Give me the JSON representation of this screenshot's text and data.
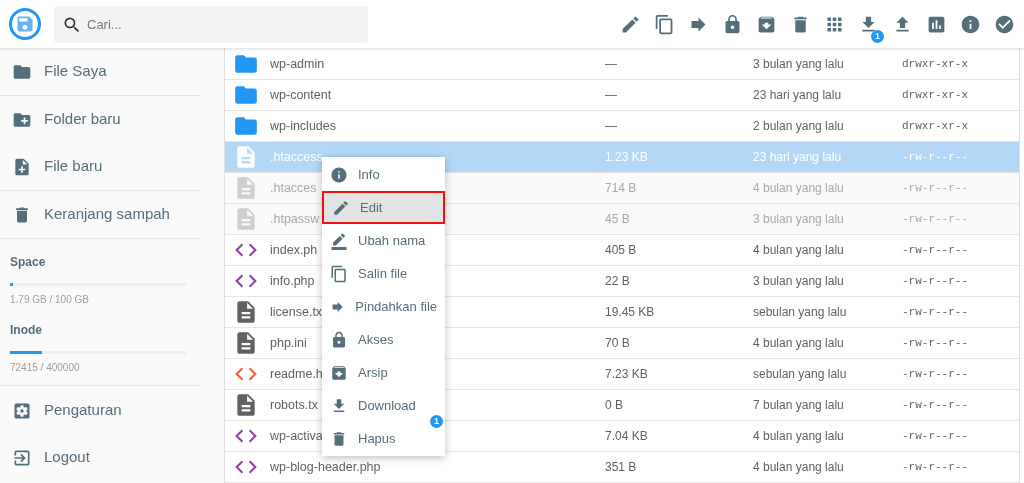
{
  "header": {
    "search": {
      "placeholder": "Cari..."
    },
    "toolbar": [
      {
        "kind": "edit"
      },
      {
        "kind": "copy"
      },
      {
        "kind": "move"
      },
      {
        "kind": "lock"
      },
      {
        "kind": "archive"
      },
      {
        "kind": "delete"
      },
      {
        "kind": "grid"
      },
      {
        "kind": "download",
        "badge": "1"
      },
      {
        "kind": "upload"
      },
      {
        "kind": "chart"
      },
      {
        "kind": "info"
      },
      {
        "kind": "check"
      }
    ]
  },
  "sidebar": {
    "top_items": [
      {
        "kind": "folder",
        "label": "File Saya"
      },
      {
        "kind": "new-folder",
        "label": "Folder baru"
      },
      {
        "kind": "new-file",
        "label": "File baru"
      },
      {
        "kind": "trash",
        "label": "Keranjang sampah"
      }
    ],
    "usage": [
      {
        "label": "Space",
        "level": 0.018,
        "reading": "1.79 GB / 100 GB"
      },
      {
        "label": "Inode",
        "level": 0.181,
        "reading": "72415 / 400000"
      }
    ],
    "bottom_items": [
      {
        "kind": "settings",
        "label": "Pengaturan"
      },
      {
        "kind": "logout",
        "label": "Logout"
      }
    ]
  },
  "files": [
    {
      "kind": "folder",
      "name": "wp-admin",
      "size": "—",
      "modified": "3 bulan yang lalu",
      "permissions": "drwxr-xr-x",
      "selected": false,
      "dimmed": false
    },
    {
      "kind": "folder",
      "name": "wp-content",
      "size": "—",
      "modified": "23 hari yang lalu",
      "permissions": "drwxr-xr-x",
      "selected": false,
      "dimmed": false
    },
    {
      "kind": "folder",
      "name": "wp-includes",
      "size": "—",
      "modified": "2 bulan yang lalu",
      "permissions": "drwxr-xr-x",
      "selected": false,
      "dimmed": false
    },
    {
      "kind": "text",
      "name": ".htaccess",
      "size": "1.23 KB",
      "modified": "23 hari yang lalu",
      "permissions": "-rw-r--r--",
      "selected": true,
      "dimmed": false
    },
    {
      "kind": "text",
      "name": ".htacces",
      "size": "714 B",
      "modified": "4 bulan yang lalu",
      "permissions": "-rw-r--r--",
      "selected": false,
      "dimmed": true
    },
    {
      "kind": "text",
      "name": ".htpassw",
      "size": "45 B",
      "modified": "3 bulan yang lalu",
      "permissions": "-rw-r--r--",
      "selected": false,
      "dimmed": true
    },
    {
      "kind": "php",
      "name": "index.ph",
      "size": "405 B",
      "modified": "4 bulan yang lalu",
      "permissions": "-rw-r--r--",
      "selected": false,
      "dimmed": false
    },
    {
      "kind": "php",
      "name": "info.php",
      "size": "22 B",
      "modified": "3 bulan yang lalu",
      "permissions": "-rw-r--r--",
      "selected": false,
      "dimmed": false
    },
    {
      "kind": "text",
      "name": "license.tx",
      "size": "19.45 KB",
      "modified": "sebulan yang lalu",
      "permissions": "-rw-r--r--",
      "selected": false,
      "dimmed": false
    },
    {
      "kind": "text",
      "name": "php.ini",
      "size": "70 B",
      "modified": "4 bulan yang lalu",
      "permissions": "-rw-r--r--",
      "selected": false,
      "dimmed": false
    },
    {
      "kind": "html",
      "name": "readme.h",
      "size": "7.23 KB",
      "modified": "sebulan yang lalu",
      "permissions": "-rw-r--r--",
      "selected": false,
      "dimmed": false
    },
    {
      "kind": "text",
      "name": "robots.tx",
      "size": "0 B",
      "modified": "7 bulan yang lalu",
      "permissions": "-rw-r--r--",
      "selected": false,
      "dimmed": false
    },
    {
      "kind": "php",
      "name": "wp-activa",
      "size": "7.04 KB",
      "modified": "4 bulan yang lalu",
      "permissions": "-rw-r--r--",
      "selected": false,
      "dimmed": false
    },
    {
      "kind": "php",
      "name": "wp-blog-header.php",
      "size": "351 B",
      "modified": "4 bulan yang lalu",
      "permissions": "-rw-r--r--",
      "selected": false,
      "dimmed": false
    }
  ],
  "context_menu": [
    {
      "kind": "info",
      "label": "Info",
      "selected": false
    },
    {
      "kind": "edit",
      "label": "Edit",
      "selected": true
    },
    {
      "kind": "rename",
      "label": "Ubah nama",
      "selected": false
    },
    {
      "kind": "copy",
      "label": "Salin file",
      "selected": false
    },
    {
      "kind": "move",
      "label": "Pindahkan file",
      "selected": false
    },
    {
      "kind": "lock",
      "label": "Akses",
      "selected": false
    },
    {
      "kind": "archive",
      "label": "Arsip",
      "selected": false
    },
    {
      "kind": "download",
      "label": "Download",
      "selected": false,
      "badge": "1"
    },
    {
      "kind": "delete",
      "label": "Hapus",
      "selected": false
    }
  ]
}
